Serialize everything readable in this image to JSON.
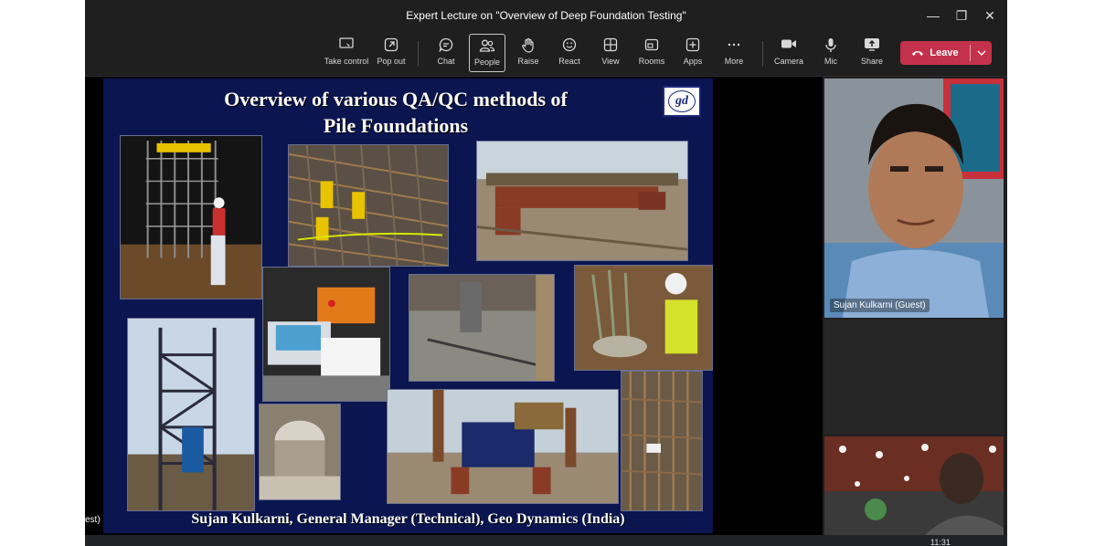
{
  "window": {
    "title": "Expert Lecture on \"Overview of Deep Foundation Testing\"",
    "controls": {
      "minimize": "—",
      "maximize": "❐",
      "close": "✕"
    }
  },
  "toolbar": {
    "take_control": "Take control",
    "pop_out": "Pop out",
    "chat": "Chat",
    "people": "People",
    "raise": "Raise",
    "react": "React",
    "view": "View",
    "rooms": "Rooms",
    "apps": "Apps",
    "more": "More",
    "camera": "Camera",
    "mic": "Mic",
    "share": "Share",
    "leave": "Leave"
  },
  "slide": {
    "title_line1": "Overview of  various QA/QC methods of",
    "title_line2": "Pile Foundations",
    "logo_text": "gd",
    "caption": "Sujan Kulkarni, General Manager (Technical), Geo Dynamics (India)"
  },
  "stage": {
    "cropped_name": "est)"
  },
  "participants": [
    {
      "name": "Sujan Kulkarni (Guest)"
    }
  ],
  "taskbar": {
    "time": "11:31"
  },
  "colors": {
    "window_bg": "#1f1f1f",
    "leave_red": "#c4314b",
    "slide_bg": "#0b1550"
  }
}
